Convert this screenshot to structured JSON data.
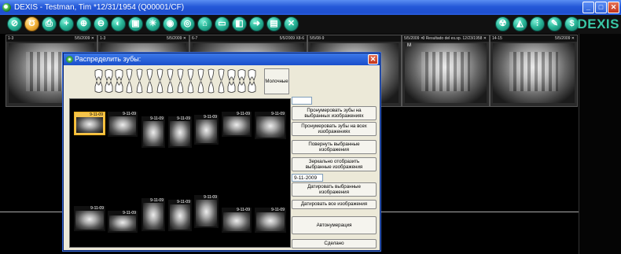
{
  "window": {
    "title": "DEXIS - Testman, Tim *12/31/1954 (Q00001/CF)",
    "logo": "DEXIS",
    "controls": [
      "_",
      "□",
      "✕"
    ]
  },
  "toolbar": {
    "left_icons": [
      "search-icon",
      "tooth-icon",
      "print-icon",
      "add-icon",
      "zoom-in-icon",
      "zoom-out-icon",
      "adjust-icon",
      "image-icon",
      "sun-icon",
      "eye-icon",
      "tooth-select-icon",
      "folder-icon",
      "open-icon",
      "save-icon",
      "export-icon",
      "stack-icon",
      "close-icon"
    ],
    "right_icons": [
      "radiation-icon",
      "measure-icon",
      "implant-icon",
      "pen-icon",
      "dollar-icon"
    ]
  },
  "background_images": [
    {
      "left": "1-3",
      "right": "5/5/2009 ✕"
    },
    {
      "left": "1-3",
      "right": "5/5/2009 ✕"
    },
    {
      "left": "6-7",
      "right": "5/5/2009 X8-6"
    },
    {
      "left": "5/5/08-9",
      "right": ""
    },
    {
      "left": "5/5/2009 ✕",
      "right": "3 Resultado del es.sp. 12/23/1958 ✕",
      "note": "M"
    },
    {
      "left": "14-15",
      "right": "5/5/2009 ✕"
    }
  ],
  "dialog": {
    "title": "Распределить зубы:",
    "close": "✕",
    "molar_button": "Молочные",
    "thumbnails_top": [
      "9-11-09",
      "9-11-09",
      "9-11-09",
      "9-11-09",
      "9-11-09",
      "9-11-09",
      "9-11-09"
    ],
    "thumbnails_bottom": [
      "9-11-09",
      "9-11-09",
      "9-11-09",
      "9-11-09",
      "9-11-09",
      "9-11-09",
      "9-11-09"
    ],
    "date_field": "9-11-2009",
    "buttons": {
      "number_selected": "Пронумеровать зубы на выбранных изображениях",
      "number_all": "Пронумеровать зубы на всех изображениях",
      "rotate": "Повернуть выбранные изображения",
      "mirror": "Зеркально отобразить выбранные изображения",
      "date_selected": "Датировать выбранные изображения",
      "date_all": "Датировать все изображения",
      "auto_number": "Автонумерация",
      "done": "Сделано"
    }
  }
}
